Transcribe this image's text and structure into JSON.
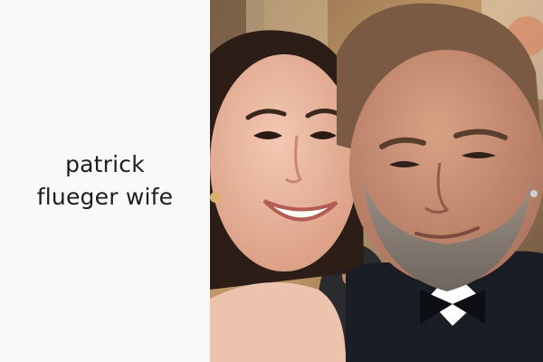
{
  "caption": {
    "line1": "patrick",
    "line2": "flueger wife"
  },
  "photo": {
    "subject": "selfie of a smiling woman and a bearded man in a bow tie",
    "colors": {
      "background_warm": "#b58d5c",
      "skin_woman": "#e9b79d",
      "skin_man": "#c98f72",
      "hair_woman": "#2c1e17",
      "hair_man": "#7a5a42",
      "beard": "#8f8579",
      "tuxedo": "#1a1d24"
    }
  }
}
